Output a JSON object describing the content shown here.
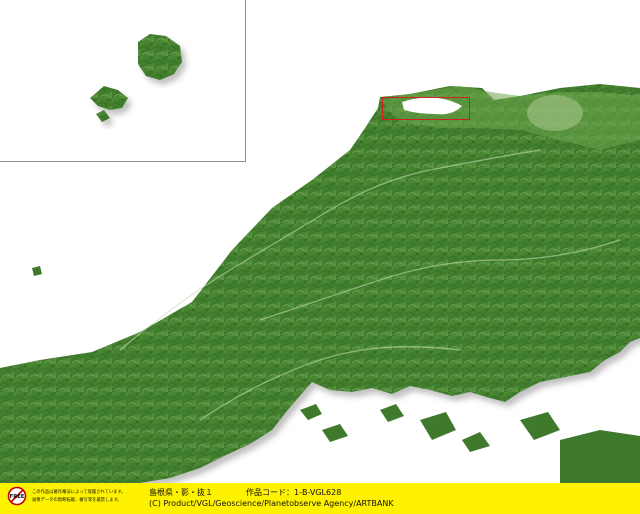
{
  "footer": {
    "badge_text": "FREE",
    "notice_line1": "この作品は著作権法によって保護されています。",
    "notice_line2": "画像データの無断転載、複写等を厳禁します。",
    "title": "島根県・影・抜１",
    "work_code": "作品コード：1-B-VGL628",
    "credit": "(C) Product/VGL/Geoscience/Planetobserve Agency/ARTBANK"
  },
  "map": {
    "land_color": "#3f7f2c",
    "sea_color": "#ffffff",
    "highlight_color": "#d31f1f",
    "footer_color": "#fff200"
  }
}
